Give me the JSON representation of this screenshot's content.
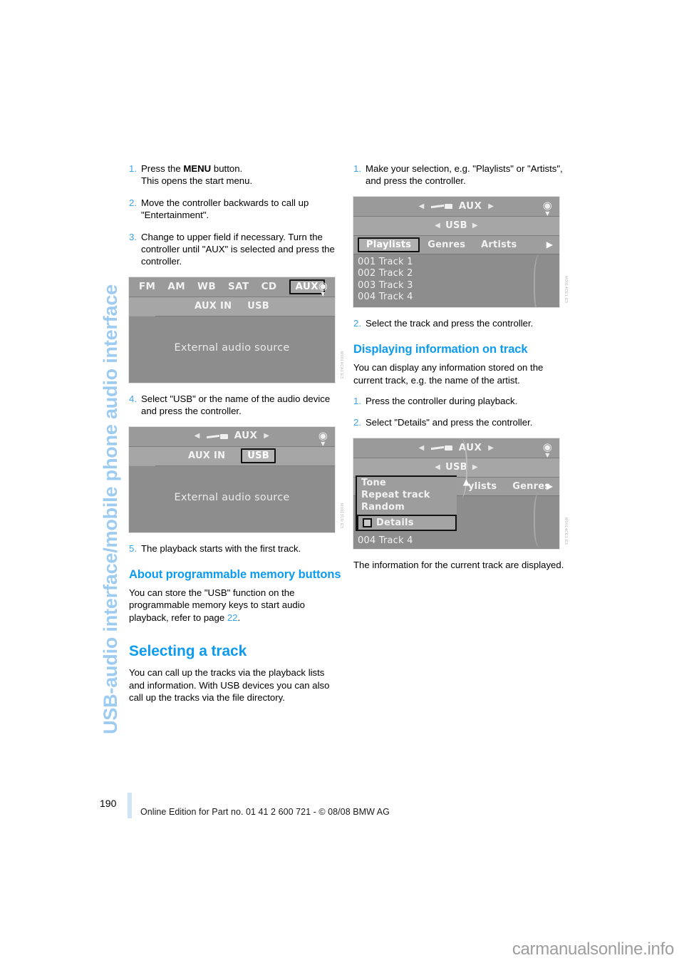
{
  "chapter_title": "USB-audio interface/mobile phone audio interface",
  "left_column": {
    "steps_1": [
      {
        "num": "1.",
        "text": "Press the MENU button.",
        "bold_word": "MENU",
        "text_before": "Press the ",
        "text_after": " button.",
        "line2": "This opens the start menu."
      },
      {
        "num": "2.",
        "text": "Move the controller backwards to call up \"Entertainment\"."
      },
      {
        "num": "3.",
        "text": "Change to upper field if necessary. Turn the controller until \"AUX\" is selected and press the controller."
      }
    ],
    "figure1": {
      "code": "M0014CA1.E3",
      "tabs": [
        "FM",
        "AM",
        "WB",
        "SAT",
        "CD",
        "AUX"
      ],
      "selected_tab": "AUX",
      "sub_items": [
        "AUX IN",
        "USB"
      ],
      "sub_selected": "",
      "set_label": "Set",
      "body_text": "External audio source"
    },
    "step_4": {
      "num": "4.",
      "text": "Select \"USB\" or the name of the audio device and press the controller."
    },
    "figure2": {
      "code": "M0013CR.E3",
      "header_label": "AUX",
      "sub_items": [
        "AUX IN",
        "USB"
      ],
      "sub_selected": "USB",
      "set_label": "Set",
      "body_text": "External audio source"
    },
    "step_5": {
      "num": "5.",
      "text": "The playback starts with the first track."
    },
    "heading_memory": "About programmable memory buttons",
    "para_memory_before": "You can store the \"USB\" function on the programmable memory keys to start audio playback, refer to page ",
    "para_memory_link": "22",
    "para_memory_after": ".",
    "heading_selecting": "Selecting a track",
    "para_selecting": "You can call up the tracks via the playback lists and information. With USB devices you can also call up the tracks via the file directory."
  },
  "right_column": {
    "step_1": {
      "num": "1.",
      "text": "Make your selection, e.g. \"Playlists\" or \"Artists\", and press the controller."
    },
    "figure3": {
      "code": "M0014CE1.E3",
      "header_label": "AUX",
      "sub_label": "USB",
      "menu_items": [
        "Playlists",
        "Genres",
        "Artists"
      ],
      "menu_selected": "Playlists",
      "tracks": [
        "001 Track 1",
        "002 Track 2",
        "003 Track 3",
        "004 Track 4"
      ]
    },
    "step_2": {
      "num": "2.",
      "text": "Select the track and press the controller."
    },
    "heading_info": "Displaying information on track",
    "para_info": "You can display any information stored on the current track, e.g. the name of the artist.",
    "steps_info": [
      {
        "num": "1.",
        "text": "Press the controller during playback."
      },
      {
        "num": "2.",
        "text": "Select \"Details\" and press the controller."
      }
    ],
    "figure4": {
      "code": "M0014CE1.E3",
      "header_label": "AUX",
      "sub_label": "USB",
      "popup_items": [
        "Tone",
        "Repeat track",
        "Random"
      ],
      "popup_checkbox_item": "Details",
      "behind_items": [
        "ylists",
        "Genres"
      ],
      "track_line": "004 Track 4"
    },
    "para_result": "The information for the current track are displayed."
  },
  "footer": {
    "page_number": "190",
    "text": "Online Edition for Part no. 01 41 2 600 721 - © 08/08 BMW AG"
  },
  "watermark": "carmanualsonline.info"
}
